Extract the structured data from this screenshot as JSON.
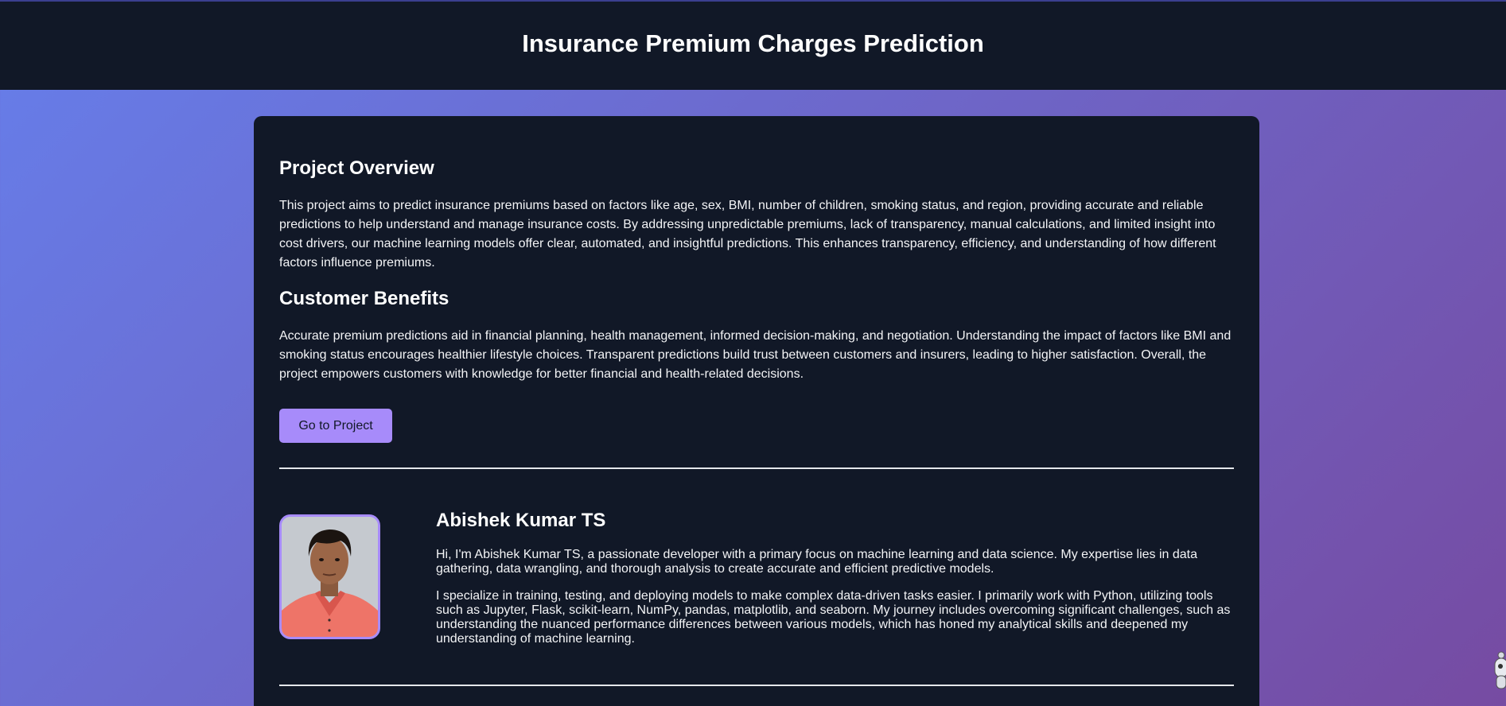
{
  "header": {
    "title": "Insurance Premium Charges Prediction"
  },
  "overview": {
    "heading": "Project Overview",
    "text": "This project aims to predict insurance premiums based on factors like age, sex, BMI, number of children, smoking status, and region, providing accurate and reliable predictions to help understand and manage insurance costs. By addressing unpredictable premiums, lack of transparency, manual calculations, and limited insight into cost drivers, our machine learning models offer clear, automated, and insightful predictions. This enhances transparency, efficiency, and understanding of how different factors influence premiums."
  },
  "benefits": {
    "heading": "Customer Benefits",
    "text": "Accurate premium predictions aid in financial planning, health management, informed decision-making, and negotiation. Understanding the impact of factors like BMI and smoking status encourages healthier lifestyle choices. Transparent predictions build trust between customers and insurers, leading to higher satisfaction. Overall, the project empowers customers with knowledge for better financial and health-related decisions."
  },
  "cta": {
    "label": "Go to Project"
  },
  "author": {
    "name": "Abishek Kumar TS",
    "bio_1": "Hi, I'm Abishek Kumar TS, a passionate developer with a primary focus on machine learning and data science. My expertise lies in data gathering, data wrangling, and thorough analysis to create accurate and efficient predictive models.",
    "bio_2": "I specialize in training, testing, and deploying models to make complex data-driven tasks easier. I primarily work with Python, utilizing tools such as Jupyter, Flask, scikit-learn, NumPy, pandas, matplotlib, and seaborn. My journey includes overcoming significant challenges, such as understanding the nuanced performance differences between various models, which has honed my analytical skills and deepened my understanding of machine learning."
  },
  "icons": {
    "avatar": "profile-photo",
    "corner": "robot-assistant-icon"
  },
  "colors": {
    "header_bg": "#111827",
    "card_bg": "#111827",
    "accent": "#a78bfa",
    "gradient_start": "#667eea",
    "gradient_end": "#764ba2"
  }
}
